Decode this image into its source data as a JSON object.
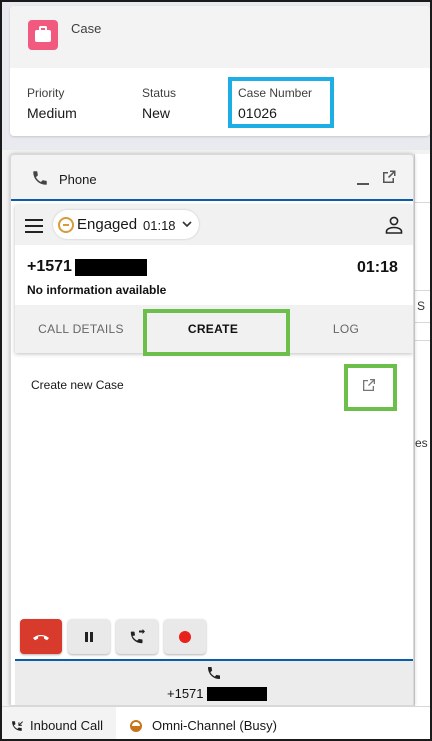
{
  "case_header": {
    "object_label": "Case",
    "fields": [
      {
        "label": "Priority",
        "value": "Medium"
      },
      {
        "label": "Status",
        "value": "New"
      },
      {
        "label": "Case Number",
        "value": "01026"
      }
    ],
    "icon_color": "#f2597e"
  },
  "phone_panel": {
    "title": "Phone",
    "minimize_icon": "minimize-icon",
    "popout_icon": "popout-icon",
    "agent_state": {
      "label": "Engaged",
      "timer": "01:18"
    },
    "call": {
      "number_prefix": "+1571",
      "duration": "01:18",
      "info": "No information available"
    },
    "tabs": [
      {
        "label": "CALL DETAILS",
        "active": false
      },
      {
        "label": "CREATE",
        "active": true
      },
      {
        "label": "LOG",
        "active": false
      }
    ],
    "create_items": [
      {
        "label": "Create new Case",
        "icon": "new-window-icon"
      }
    ],
    "controls": [
      {
        "name": "end-call",
        "icon": "hangup-icon"
      },
      {
        "name": "hold",
        "icon": "pause-icon"
      },
      {
        "name": "transfer",
        "icon": "transfer-icon"
      },
      {
        "name": "record",
        "icon": "record-icon"
      }
    ],
    "bottom_call": {
      "number_prefix": "+1571"
    }
  },
  "side_strip": {
    "texts": [
      "S",
      "es"
    ]
  },
  "utility_bar": {
    "inbound_label": "Inbound Call",
    "omni_label": "Omni-Channel (Busy)"
  },
  "colors": {
    "highlight_blue": "#1eaee6",
    "highlight_green": "#6cbf4b",
    "accent_blue": "#0b5cab",
    "end_call_red": "#d83a2b",
    "record_red": "#e8211a",
    "engaged_amber": "#d79b3b"
  }
}
